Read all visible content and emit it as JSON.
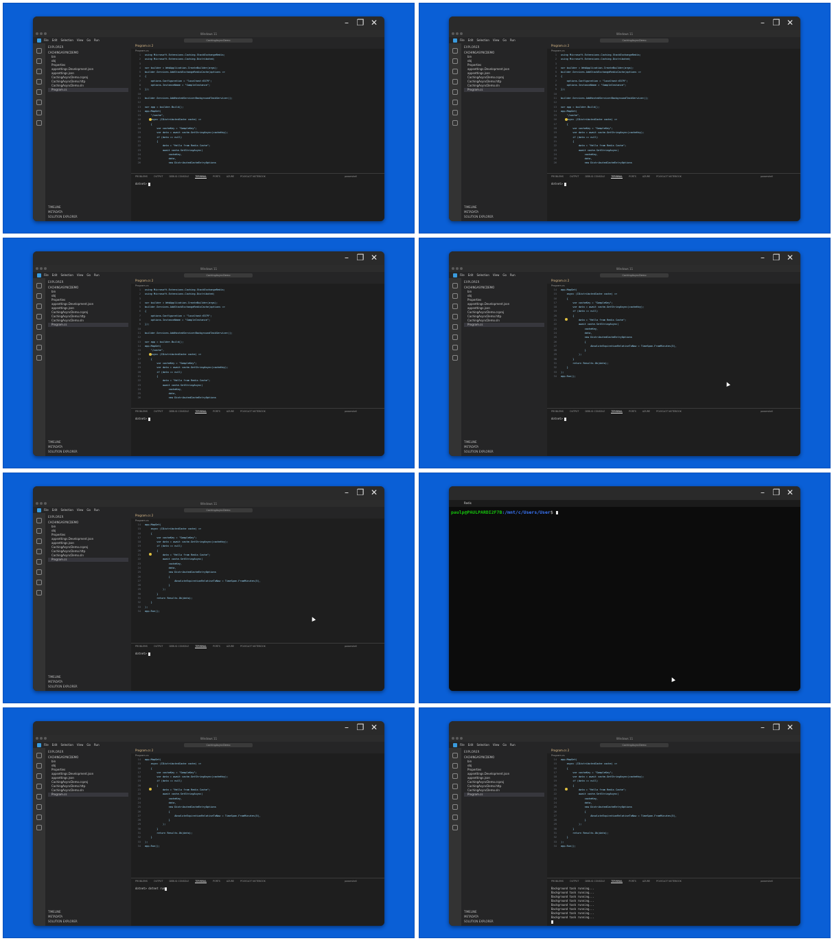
{
  "window": {
    "title": "Windows 11",
    "min": "–",
    "max": "❐",
    "close": "✕"
  },
  "menu": {
    "items": [
      "File",
      "Edit",
      "Selection",
      "View",
      "Go",
      "Run"
    ],
    "search": "CachingAsyncDemo"
  },
  "explorer": {
    "header": "EXPLORER",
    "project": "CACHINGASYNCDEMO",
    "items": [
      "bin",
      "obj",
      "Properties",
      "appsettings.Development.json",
      "appsettings.json",
      "CachingAsyncDemo.csproj",
      "CachingAsyncDemo.http",
      "CachingAsyncDemo.sln",
      "Program.cs"
    ],
    "footer": [
      "TIMELINE",
      "METADATA",
      "SOLUTION EXPLORER"
    ]
  },
  "editor": {
    "tab": "Program.cs 2",
    "breadcrumb": "Program.cs"
  },
  "panel": {
    "tabs": [
      "PROBLEMS",
      "OUTPUT",
      "DEBUG CONSOLE",
      "TERMINAL",
      "PORTS",
      "AZURE",
      "POLYGLOT NOTEBOOK"
    ],
    "shell": "powershell",
    "prompt": "dotnet>",
    "command": "dotnet run",
    "background_line": "Background task running..."
  },
  "code_top": [
    {
      "n": "1",
      "t": "using Microsoft.Extensions.Caching.StackExchangeRedis;"
    },
    {
      "n": "2",
      "t": "using Microsoft.Extensions.Caching.Distributed;"
    },
    {
      "n": "3",
      "t": ""
    },
    {
      "n": "4",
      "t": "var builder = WebApplication.CreateBuilder(args);"
    },
    {
      "n": "5",
      "t": "builder.Services.AddStackExchangeRedisCache(options =>"
    },
    {
      "n": "6",
      "t": "{"
    },
    {
      "n": "7",
      "t": "    options.Configuration = \"localhost:6379\";"
    },
    {
      "n": "8",
      "t": "    options.InstanceName = \"SampleInstance\";"
    },
    {
      "n": "9",
      "t": "});"
    },
    {
      "n": "10",
      "t": ""
    },
    {
      "n": "11",
      "t": "builder.Services.AddHostedService<BackgroundTaskService>();"
    },
    {
      "n": "12",
      "t": ""
    },
    {
      "n": "13",
      "t": "var app = builder.Build();"
    },
    {
      "n": "14",
      "t": "app.MapGet("
    },
    {
      "n": "15",
      "t": "    \"/cache\","
    },
    {
      "n": "16",
      "t": "    async (IDistributedCache cache) =>"
    },
    {
      "n": "17",
      "t": "    {"
    },
    {
      "n": "18",
      "t": "        var cacheKey = \"SampleKey\";"
    },
    {
      "n": "19",
      "t": "        var data = await cache.GetStringAsync(cacheKey);"
    },
    {
      "n": "20",
      "t": "        if (data == null)"
    },
    {
      "n": "21",
      "t": "        {"
    },
    {
      "n": "22",
      "t": "            data = \"Hello from Redis Cache\";"
    },
    {
      "n": "23",
      "t": "            await cache.SetStringAsync("
    },
    {
      "n": "24",
      "t": "                cacheKey,"
    },
    {
      "n": "25",
      "t": "                data,"
    },
    {
      "n": "26",
      "t": "                new DistributedCacheEntryOptions"
    }
  ],
  "code_bottom": [
    {
      "n": "14",
      "t": "app.MapGet("
    },
    {
      "n": "15",
      "t": "    async (IDistributedCache cache) =>"
    },
    {
      "n": "16",
      "t": "    {"
    },
    {
      "n": "17",
      "t": "        var cacheKey = \"SampleKey\";"
    },
    {
      "n": "18",
      "t": "        var data = await cache.GetStringAsync(cacheKey);"
    },
    {
      "n": "19",
      "t": "        if (data == null)"
    },
    {
      "n": "20",
      "t": "        {"
    },
    {
      "n": "21",
      "t": "            data = \"Hello from Redis Cache\";"
    },
    {
      "n": "22",
      "t": "            await cache.SetStringAsync("
    },
    {
      "n": "23",
      "t": "                cacheKey,"
    },
    {
      "n": "24",
      "t": "                data,"
    },
    {
      "n": "25",
      "t": "                new DistributedCacheEntryOptions"
    },
    {
      "n": "26",
      "t": "                {"
    },
    {
      "n": "27",
      "t": "                    AbsoluteExpirationRelativeToNow = TimeSpan.FromMinutes(5),"
    },
    {
      "n": "28",
      "t": "                }"
    },
    {
      "n": "29",
      "t": "            );"
    },
    {
      "n": "30",
      "t": "        }"
    },
    {
      "n": "31",
      "t": "        return Results.Ok(data);"
    },
    {
      "n": "32",
      "t": "    }"
    },
    {
      "n": "33",
      "t": ");"
    },
    {
      "n": "34",
      "t": "app.Run();"
    }
  ],
  "redis_terminal": {
    "tab": "Redis",
    "user": "paulp@PAULPARDI2F7B",
    "path": ":/mnt/c/Users/User",
    "symbol": "$"
  }
}
